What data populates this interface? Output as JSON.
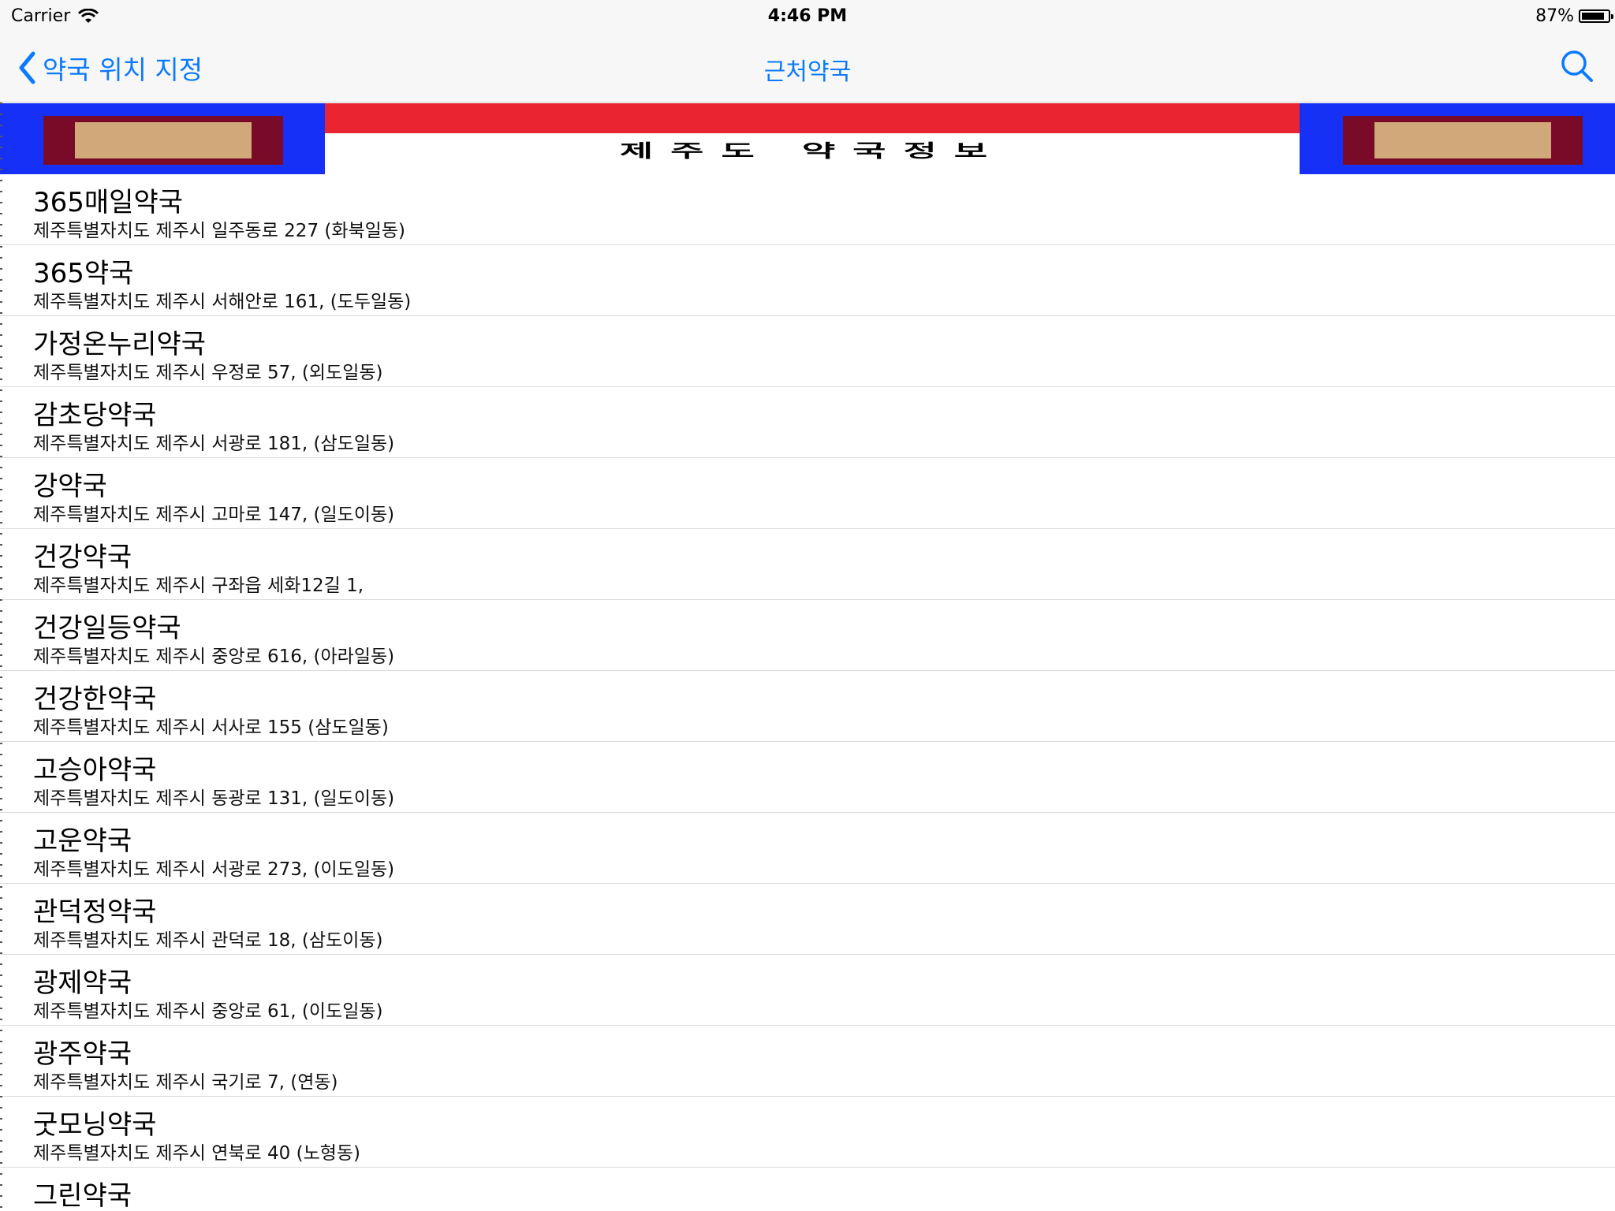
{
  "status_bar": {
    "carrier": "Carrier",
    "time": "4:46 PM",
    "battery_percent": "87%",
    "battery_level": 0.87
  },
  "nav": {
    "back_label": "약국 위치 지정",
    "title": "근처약국",
    "search_icon": "search-icon"
  },
  "banner": {
    "title": "제주도 약국정보",
    "colors": {
      "red": "#ea2430",
      "blue": "#1631f5",
      "maroon": "#7a0b28",
      "tan": "#d1a87a"
    }
  },
  "accent_color": "#0a7aff",
  "pharmacies": [
    {
      "name": "365매일약국",
      "address": "제주특별자치도 제주시 일주동로 227 (화북일동)"
    },
    {
      "name": "365약국",
      "address": "제주특별자치도 제주시 서해안로 161, (도두일동)"
    },
    {
      "name": "가정온누리약국",
      "address": "제주특별자치도 제주시 우정로 57, (외도일동)"
    },
    {
      "name": "감초당약국",
      "address": "제주특별자치도 제주시 서광로 181, (삼도일동)"
    },
    {
      "name": "강약국",
      "address": "제주특별자치도 제주시 고마로 147, (일도이동)"
    },
    {
      "name": "건강약국",
      "address": "제주특별자치도 제주시 구좌읍 세화12길 1,"
    },
    {
      "name": "건강일등약국",
      "address": "제주특별자치도 제주시 중앙로 616, (아라일동)"
    },
    {
      "name": "건강한약국",
      "address": "제주특별자치도 제주시 서사로 155 (삼도일동)"
    },
    {
      "name": "고승아약국",
      "address": "제주특별자치도 제주시 동광로 131, (일도이동)"
    },
    {
      "name": "고운약국",
      "address": "제주특별자치도 제주시 서광로 273, (이도일동)"
    },
    {
      "name": "관덕정약국",
      "address": "제주특별자치도 제주시 관덕로 18, (삼도이동)"
    },
    {
      "name": "광제약국",
      "address": "제주특별자치도 제주시 중앙로 61, (이도일동)"
    },
    {
      "name": "광주약국",
      "address": "제주특별자치도 제주시 국기로 7, (연동)"
    },
    {
      "name": "굿모닝약국",
      "address": "제주특별자치도 제주시 연북로 40 (노형동)"
    },
    {
      "name": "그린약국",
      "address": ""
    }
  ]
}
